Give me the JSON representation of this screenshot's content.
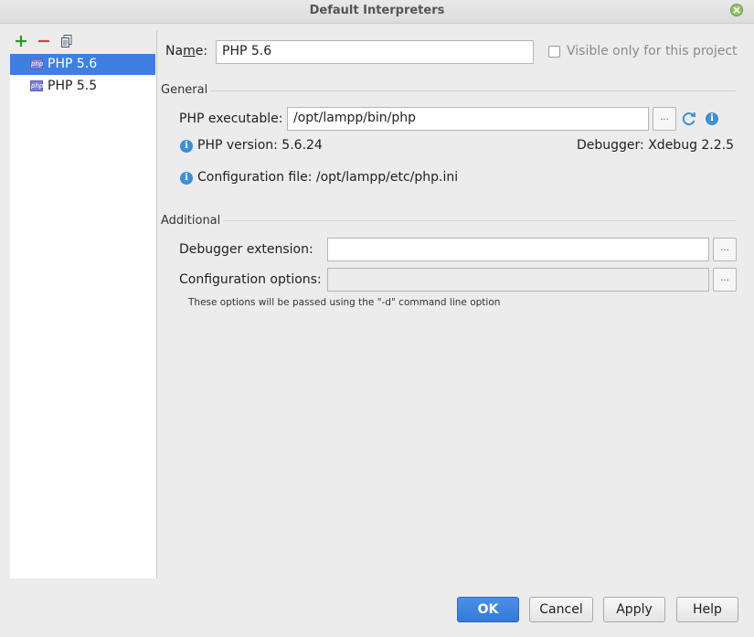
{
  "window": {
    "title": "Default Interpreters"
  },
  "interpreters": [
    {
      "label": "PHP 5.6",
      "selected": true
    },
    {
      "label": "PHP 5.5",
      "selected": false
    }
  ],
  "form": {
    "name_label_pre": "Na",
    "name_label_underlined": "m",
    "name_label_post": "e:",
    "name_value": "PHP 5.6",
    "visible_only_label": "Visible only for this project",
    "visible_only_checked": false,
    "general": {
      "section_label": "General",
      "executable_label": "PHP executable:",
      "executable_value": "/opt/lampp/bin/php",
      "browse_label": "...",
      "php_version": "PHP version: 5.6.24",
      "debugger": "Debugger: Xdebug 2.2.5",
      "config_file": "Configuration file: /opt/lampp/etc/php.ini"
    },
    "additional": {
      "section_label": "Additional",
      "debugger_ext_label": "Debugger extension:",
      "debugger_ext_value": "",
      "config_options_label": "Configuration options:",
      "config_options_value": "",
      "browse_label": "...",
      "hint": "These options will be passed using the \"-d\" command line option"
    }
  },
  "buttons": {
    "ok": "OK",
    "cancel": "Cancel",
    "apply": "Apply",
    "help": "Help"
  },
  "colors": {
    "selection": "#3d80df",
    "add_icon": "#2a9a2a",
    "remove_icon": "#d23c3c",
    "info_icon": "#3f8fd2"
  },
  "icons": [
    "add-icon",
    "remove-icon",
    "copy-icon",
    "php-icon",
    "info-icon",
    "refresh-icon",
    "close-icon"
  ]
}
